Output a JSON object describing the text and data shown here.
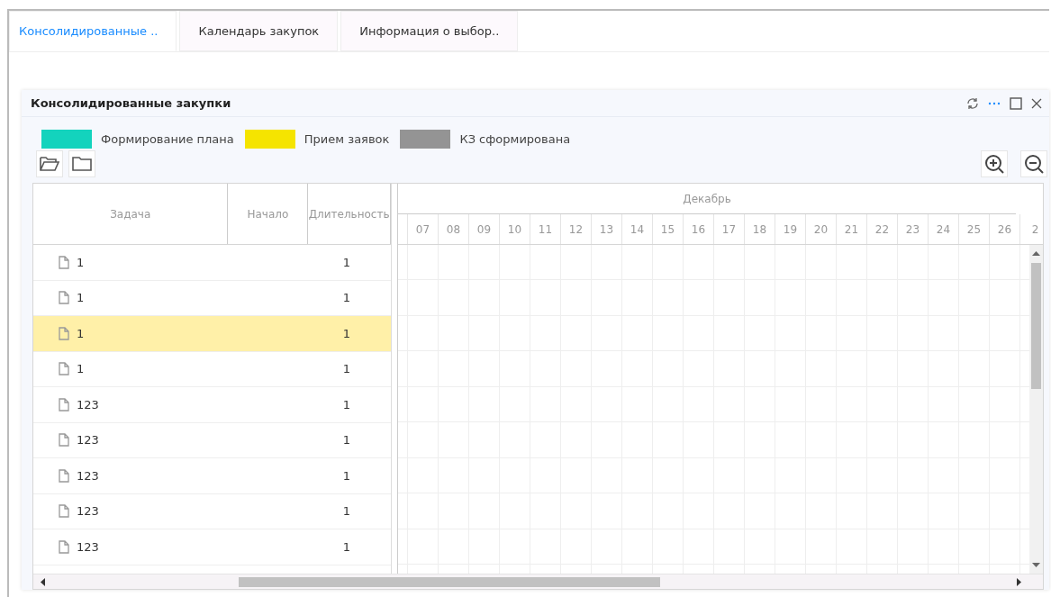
{
  "tabs": [
    {
      "label": "Консолидированные ..",
      "selected": true
    },
    {
      "label": "Календарь закупок",
      "selected": false
    },
    {
      "label": "Информация о выбор..",
      "selected": false
    }
  ],
  "panel": {
    "title": "Консолидированные закупки",
    "legend": [
      {
        "label": "Формирование плана",
        "color": "#13d3bd"
      },
      {
        "label": "Прием заявок",
        "color": "#f5e400"
      },
      {
        "label": "КЗ сформирована",
        "color": "#949494"
      }
    ],
    "table": {
      "columns": [
        "Задача",
        "Начало",
        "Длительность"
      ],
      "rows": [
        {
          "task": "1",
          "start": "",
          "duration": "1",
          "selected": false
        },
        {
          "task": "1",
          "start": "",
          "duration": "1",
          "selected": false
        },
        {
          "task": "1",
          "start": "",
          "duration": "1",
          "selected": true
        },
        {
          "task": "1",
          "start": "",
          "duration": "1",
          "selected": false
        },
        {
          "task": "123",
          "start": "",
          "duration": "1",
          "selected": false
        },
        {
          "task": "123",
          "start": "",
          "duration": "1",
          "selected": false
        },
        {
          "task": "123",
          "start": "",
          "duration": "1",
          "selected": false
        },
        {
          "task": "123",
          "start": "",
          "duration": "1",
          "selected": false
        },
        {
          "task": "123",
          "start": "",
          "duration": "1",
          "selected": false
        }
      ]
    },
    "timeline": {
      "month": "Декабрь",
      "days": [
        "07",
        "08",
        "09",
        "10",
        "11",
        "12",
        "13",
        "14",
        "15",
        "16",
        "17",
        "18",
        "19",
        "20",
        "21",
        "22",
        "23",
        "24",
        "25",
        "26",
        "2"
      ]
    }
  }
}
